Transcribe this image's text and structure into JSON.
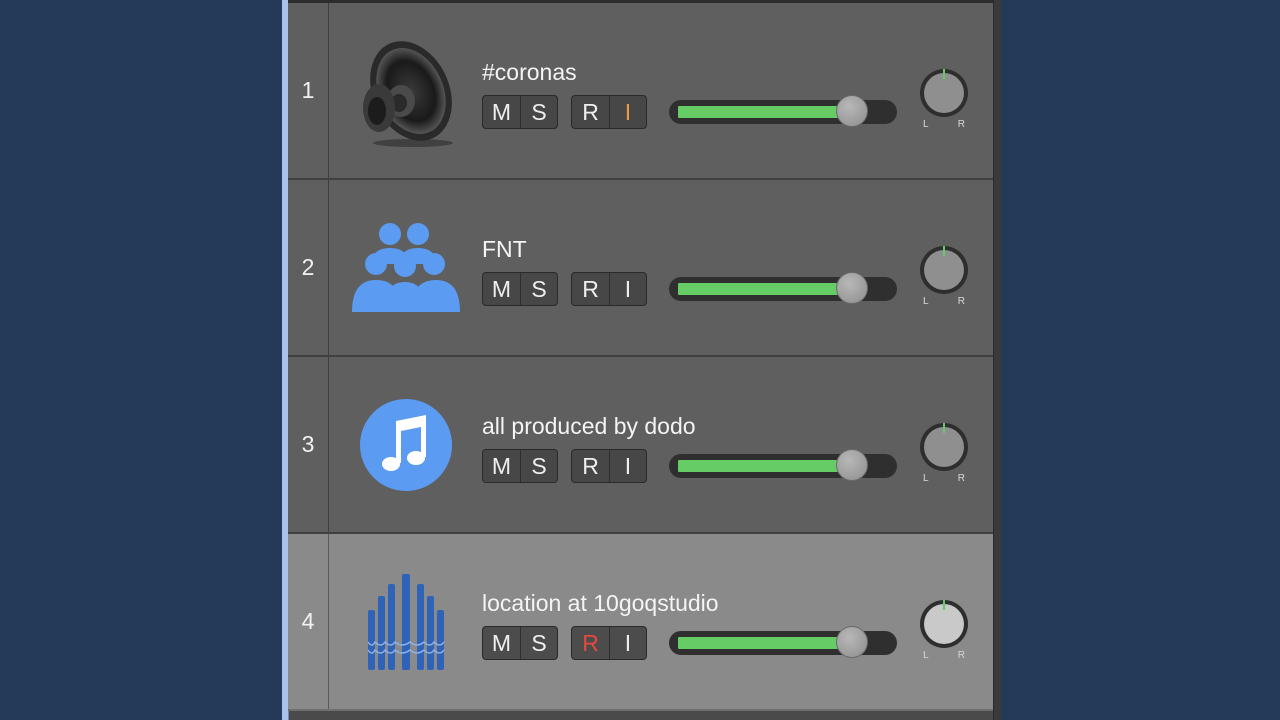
{
  "tracks": [
    {
      "number": "1",
      "name": "#coronas",
      "icon": "speaker-icon",
      "buttons": {
        "mute": "M",
        "solo": "S",
        "record": "R",
        "input": "I"
      },
      "input_active": true,
      "record_active": false,
      "volume_fraction": 0.83,
      "pan": {
        "left": "L",
        "right": "R"
      },
      "selected": false
    },
    {
      "number": "2",
      "name": "FNT",
      "icon": "group-people-icon",
      "buttons": {
        "mute": "M",
        "solo": "S",
        "record": "R",
        "input": "I"
      },
      "input_active": false,
      "record_active": false,
      "volume_fraction": 0.83,
      "pan": {
        "left": "L",
        "right": "R"
      },
      "selected": false
    },
    {
      "number": "3",
      "name": "all produced by dodo",
      "icon": "music-note-icon",
      "buttons": {
        "mute": "M",
        "solo": "S",
        "record": "R",
        "input": "I"
      },
      "input_active": false,
      "record_active": false,
      "volume_fraction": 0.83,
      "pan": {
        "left": "L",
        "right": "R"
      },
      "selected": false
    },
    {
      "number": "4",
      "name": "location at 10goqstudio",
      "icon": "pipe-organ-icon",
      "buttons": {
        "mute": "M",
        "solo": "S",
        "record": "R",
        "input": "I"
      },
      "input_active": false,
      "record_active": true,
      "volume_fraction": 0.83,
      "pan": {
        "left": "L",
        "right": "R"
      },
      "selected": true
    }
  ],
  "colors": {
    "input_active": "#e89a3c",
    "record_active": "#e5483d",
    "volume_fill": "#66cc66",
    "icon_blue": "#5b9cf2",
    "organ_blue": "#2f63b8"
  }
}
